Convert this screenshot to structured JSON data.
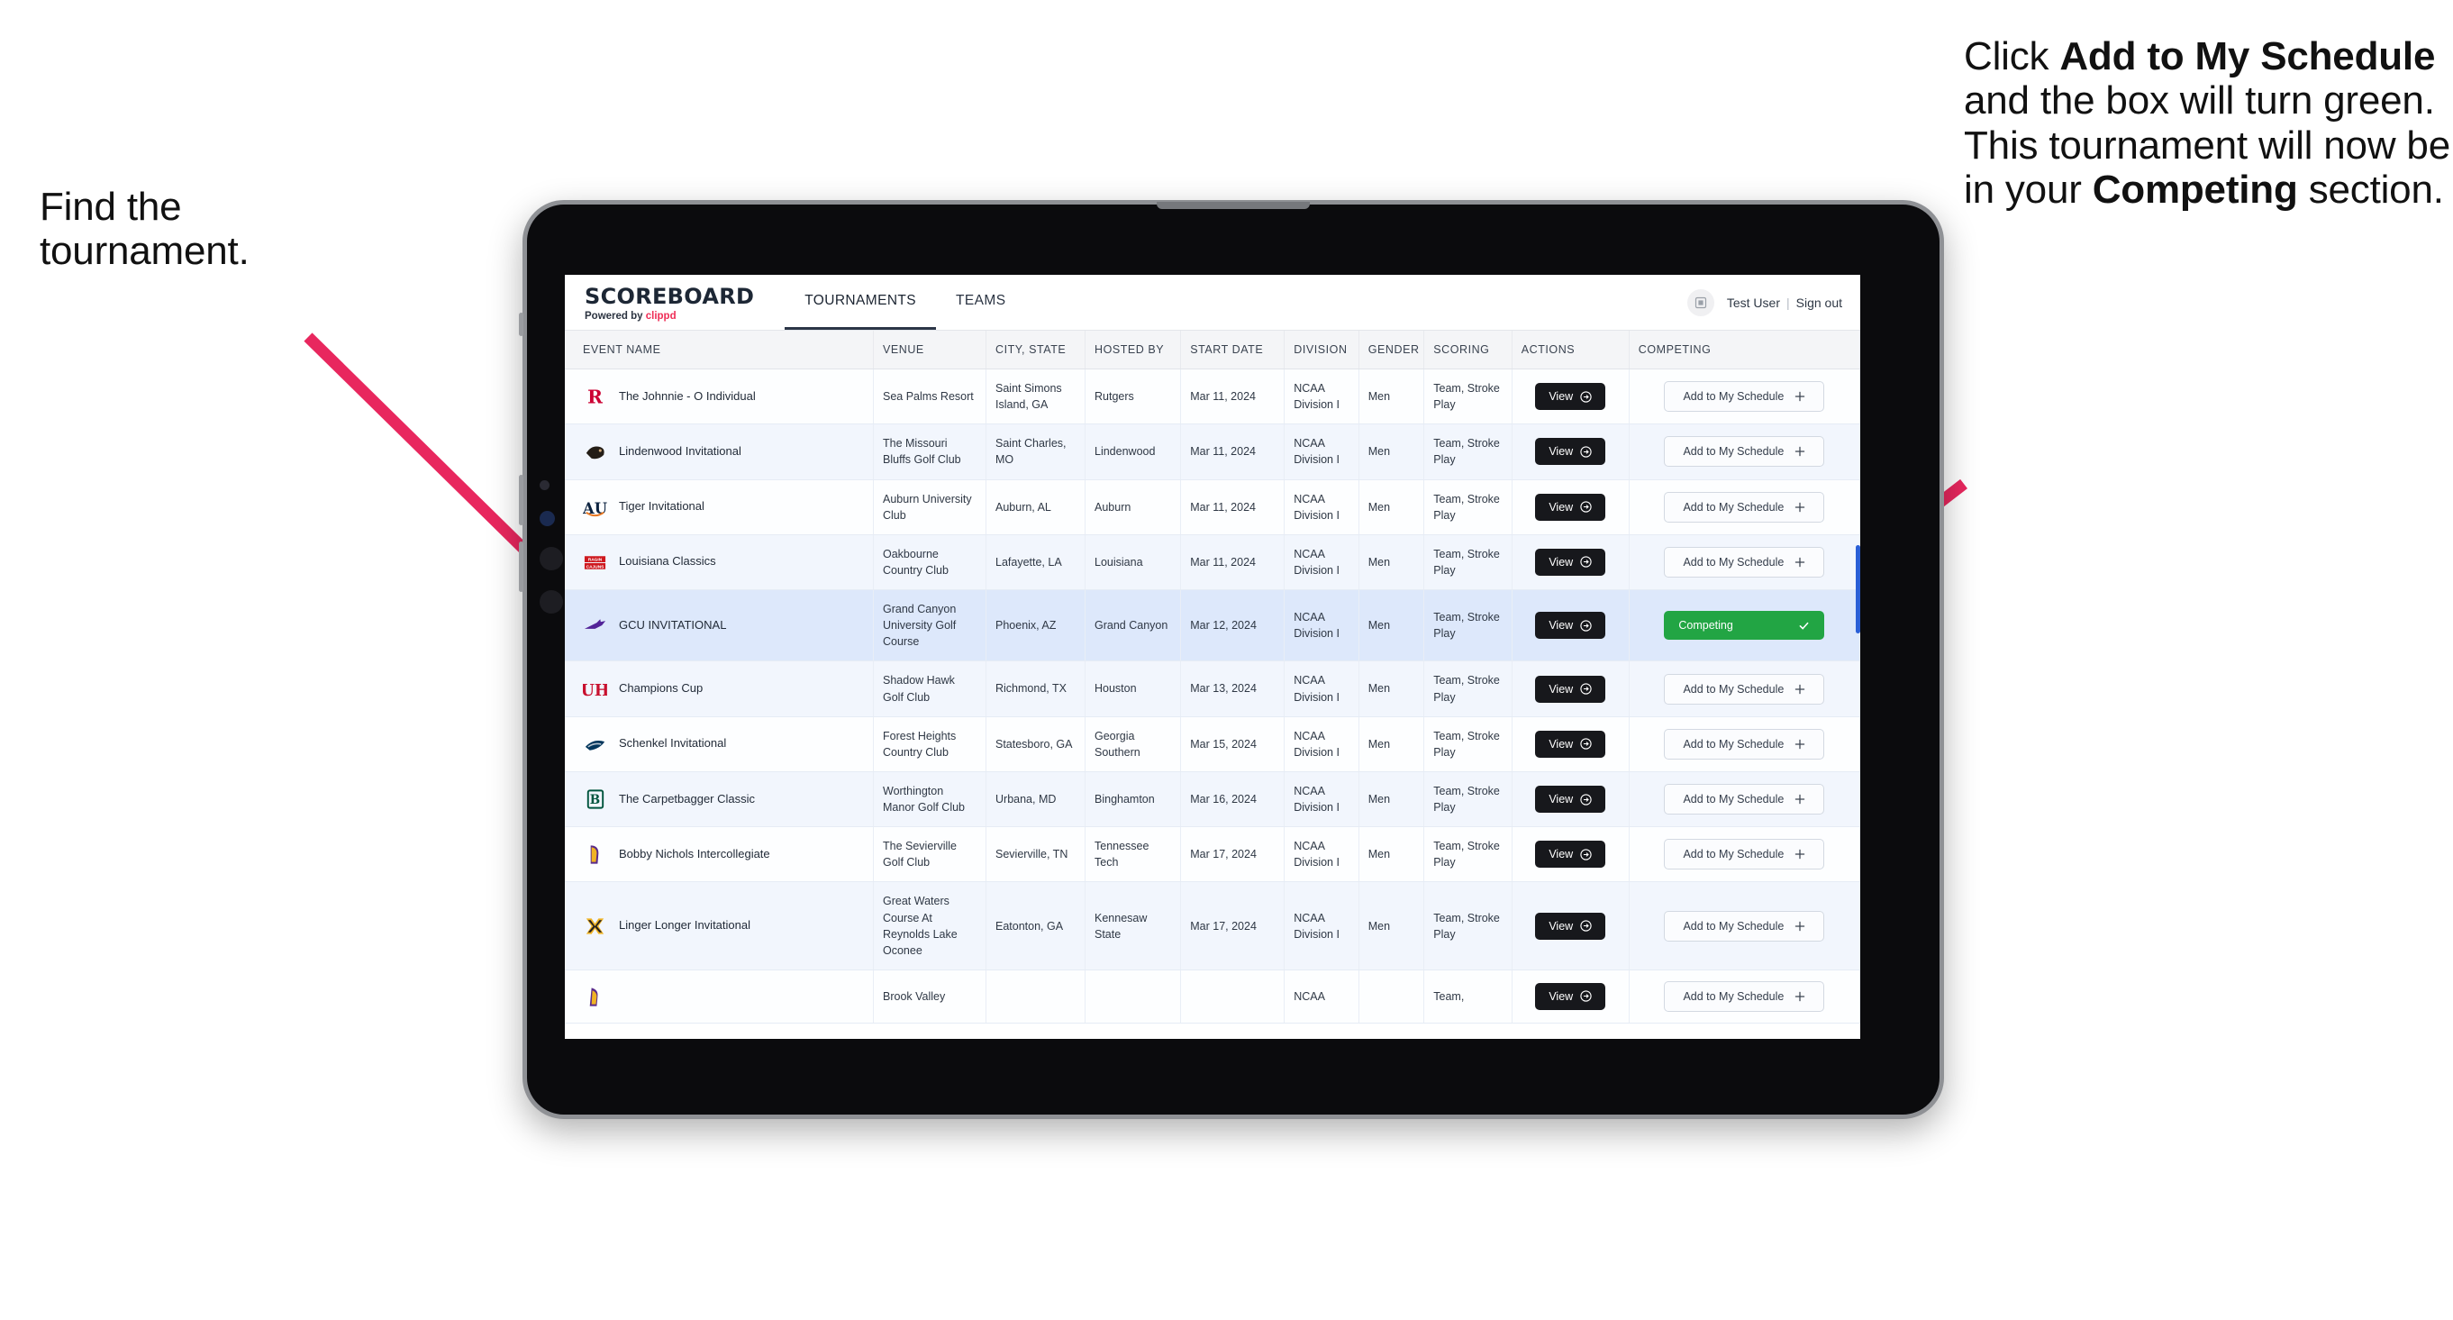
{
  "annotations": {
    "left": {
      "line1": "Find the",
      "line2": "tournament."
    },
    "right": {
      "seg1": "Click ",
      "bold1": "Add to My Schedule",
      "seg2": " and the box will turn green. This tournament will now be in your ",
      "bold2": "Competing",
      "seg3": " section."
    },
    "arrow_color": "#e8275e"
  },
  "app": {
    "brand": {
      "title": "SCOREBOARD",
      "powered_prefix": "Powered by ",
      "powered_brand": "clippd"
    },
    "nav": [
      {
        "label": "TOURNAMENTS",
        "active": true
      },
      {
        "label": "TEAMS",
        "active": false
      }
    ],
    "user": {
      "name": "Test User",
      "separator": "|",
      "signout": "Sign out",
      "avatar_icon": "user-avatar-icon"
    },
    "table": {
      "columns": [
        "EVENT NAME",
        "VENUE",
        "CITY, STATE",
        "HOSTED BY",
        "START DATE",
        "DIVISION",
        "GENDER",
        "SCORING",
        "ACTIONS",
        "COMPETING"
      ],
      "view_label": "View",
      "add_label": "Add to My Schedule",
      "add_icon": "plus-icon",
      "competing_label": "Competing",
      "competing_icon": "check-icon",
      "competing_color": "#22a544",
      "rows": [
        {
          "event": "The Johnnie - O Individual",
          "logo": "rutgers-logo",
          "venue": "Sea Palms Resort",
          "city": "Saint Simons Island, GA",
          "host": "Rutgers",
          "date": "Mar 11, 2024",
          "division": "NCAA Division I",
          "gender": "Men",
          "scoring": "Team, Stroke Play",
          "competing": false,
          "selected": false
        },
        {
          "event": "Lindenwood Invitational",
          "logo": "lindenwood-logo",
          "venue": "The Missouri Bluffs Golf Club",
          "city": "Saint Charles, MO",
          "host": "Lindenwood",
          "date": "Mar 11, 2024",
          "division": "NCAA Division I",
          "gender": "Men",
          "scoring": "Team, Stroke Play",
          "competing": false,
          "selected": false
        },
        {
          "event": "Tiger Invitational",
          "logo": "auburn-logo",
          "venue": "Auburn University Club",
          "city": "Auburn, AL",
          "host": "Auburn",
          "date": "Mar 11, 2024",
          "division": "NCAA Division I",
          "gender": "Men",
          "scoring": "Team, Stroke Play",
          "competing": false,
          "selected": false
        },
        {
          "event": "Louisiana Classics",
          "logo": "louisiana-logo",
          "venue": "Oakbourne Country Club",
          "city": "Lafayette, LA",
          "host": "Louisiana",
          "date": "Mar 11, 2024",
          "division": "NCAA Division I",
          "gender": "Men",
          "scoring": "Team, Stroke Play",
          "competing": false,
          "selected": false
        },
        {
          "event": "GCU INVITATIONAL",
          "logo": "gcu-logo",
          "venue": "Grand Canyon University Golf Course",
          "city": "Phoenix, AZ",
          "host": "Grand Canyon",
          "date": "Mar 12, 2024",
          "division": "NCAA Division I",
          "gender": "Men",
          "scoring": "Team, Stroke Play",
          "competing": true,
          "selected": true
        },
        {
          "event": "Champions Cup",
          "logo": "houston-logo",
          "venue": "Shadow Hawk Golf Club",
          "city": "Richmond, TX",
          "host": "Houston",
          "date": "Mar 13, 2024",
          "division": "NCAA Division I",
          "gender": "Men",
          "scoring": "Team, Stroke Play",
          "competing": false,
          "selected": false
        },
        {
          "event": "Schenkel Invitational",
          "logo": "georgia-southern-logo",
          "venue": "Forest Heights Country Club",
          "city": "Statesboro, GA",
          "host": "Georgia Southern",
          "date": "Mar 15, 2024",
          "division": "NCAA Division I",
          "gender": "Men",
          "scoring": "Team, Stroke Play",
          "competing": false,
          "selected": false
        },
        {
          "event": "The Carpetbagger Classic",
          "logo": "binghamton-logo",
          "venue": "Worthington Manor Golf Club",
          "city": "Urbana, MD",
          "host": "Binghamton",
          "date": "Mar 16, 2024",
          "division": "NCAA Division I",
          "gender": "Men",
          "scoring": "Team, Stroke Play",
          "competing": false,
          "selected": false
        },
        {
          "event": "Bobby Nichols Intercollegiate",
          "logo": "tennessee-tech-logo",
          "venue": "The Sevierville Golf Club",
          "city": "Sevierville, TN",
          "host": "Tennessee Tech",
          "date": "Mar 17, 2024",
          "division": "NCAA Division I",
          "gender": "Men",
          "scoring": "Team, Stroke Play",
          "competing": false,
          "selected": false
        },
        {
          "event": "Linger Longer Invitational",
          "logo": "kennesaw-state-logo",
          "venue": "Great Waters Course At Reynolds Lake Oconee",
          "city": "Eatonton, GA",
          "host": "Kennesaw State",
          "date": "Mar 17, 2024",
          "division": "NCAA Division I",
          "gender": "Men",
          "scoring": "Team, Stroke Play",
          "competing": false,
          "selected": false
        },
        {
          "event": "",
          "logo": "ecu-logo",
          "venue": "Brook Valley",
          "city": "",
          "host": "",
          "date": "",
          "division": "NCAA",
          "gender": "",
          "scoring": "Team,",
          "competing": false,
          "selected": false
        }
      ]
    }
  }
}
